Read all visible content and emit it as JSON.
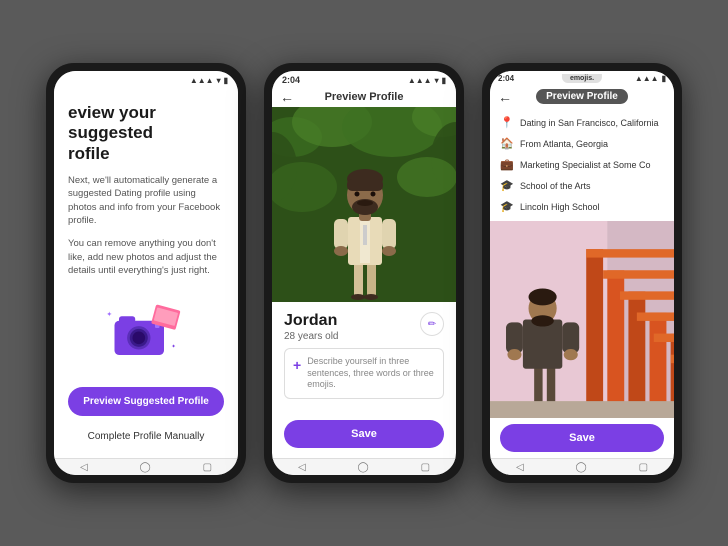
{
  "phones": {
    "phone1": {
      "screen": {
        "title_line1": "eview your suggested",
        "title_line2": "rofile",
        "description1": "Next, we'll automatically generate a suggested Dating profile using photos and info from your Facebook profile.",
        "description2": "You can remove anything you don't like, add new photos and adjust the details until everything's just right.",
        "btn_preview": "Preview Suggested Profile",
        "btn_manual": "Complete Profile Manually"
      },
      "nav": [
        "◁",
        "◯",
        "▢"
      ]
    },
    "phone2": {
      "status": {
        "time": "2:04",
        "icons": "▲▲▲"
      },
      "header": {
        "back": "←",
        "title": "Preview Profile"
      },
      "profile": {
        "name": "Jordan",
        "age": "28 years old",
        "bio_placeholder": "Describe yourself in three sentences, three words or three emojis.",
        "save_label": "Save"
      },
      "nav": [
        "◁",
        "◯",
        "▢"
      ]
    },
    "phone3": {
      "status": {
        "time": "2:04",
        "notification": "emojis."
      },
      "header": {
        "back": "←",
        "title": "Preview Profile"
      },
      "details": [
        {
          "icon": "📍",
          "text": "Dating in San Francisco, California"
        },
        {
          "icon": "🏠",
          "text": "From Atlanta, Georgia"
        },
        {
          "icon": "💼",
          "text": "Marketing Specialist at Some Co"
        },
        {
          "icon": "🎓",
          "text": "School of the Arts"
        },
        {
          "icon": "🎓",
          "text": "Lincoln High School"
        }
      ],
      "save_label": "Save",
      "nav": [
        "◁",
        "◯",
        "▢"
      ]
    }
  }
}
